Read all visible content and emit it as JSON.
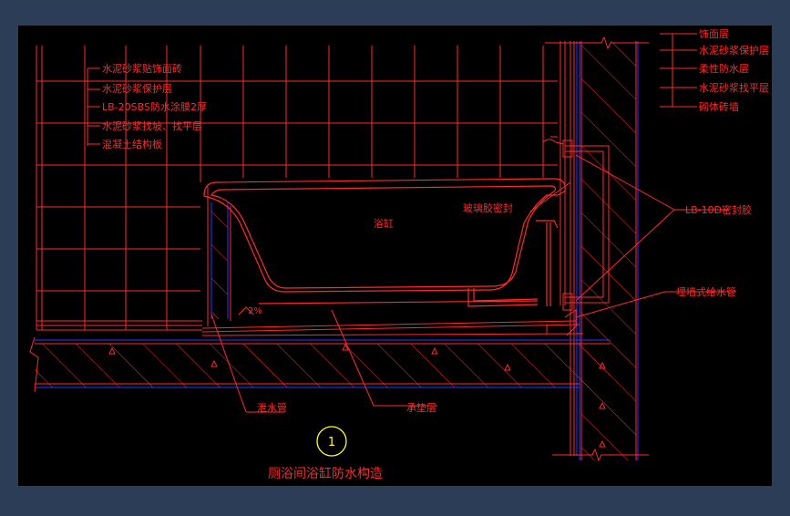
{
  "colors": {
    "frame": "#2b3d57",
    "canvas": "#000000",
    "red": "#ff2a2a",
    "blue": "#2a3cff",
    "yellow": "#ffff33",
    "white": "#e8e8e8"
  },
  "labels_left": [
    "水泥砂浆贴饰面砖",
    "水泥砂浆保护层",
    "LB-20SBS防水涂膜2厚",
    "水泥砂浆找坡、找平层",
    "混凝土结构板"
  ],
  "labels_right": [
    "饰面层",
    "水泥砂浆保护层",
    "柔性防水层",
    "水泥砂浆找平层",
    "砌体砖墙"
  ],
  "label_bathtub": "浴缸",
  "label_glass_glue": "玻璃胶密封",
  "label_sealant": "LB-10D密封胶",
  "label_pipe": "埋墙式给水管",
  "label_slope": "2%",
  "label_drain": "泄水管",
  "label_bed": "承垫层",
  "detail_number": "1",
  "caption": "厕浴间浴缸防水构造"
}
